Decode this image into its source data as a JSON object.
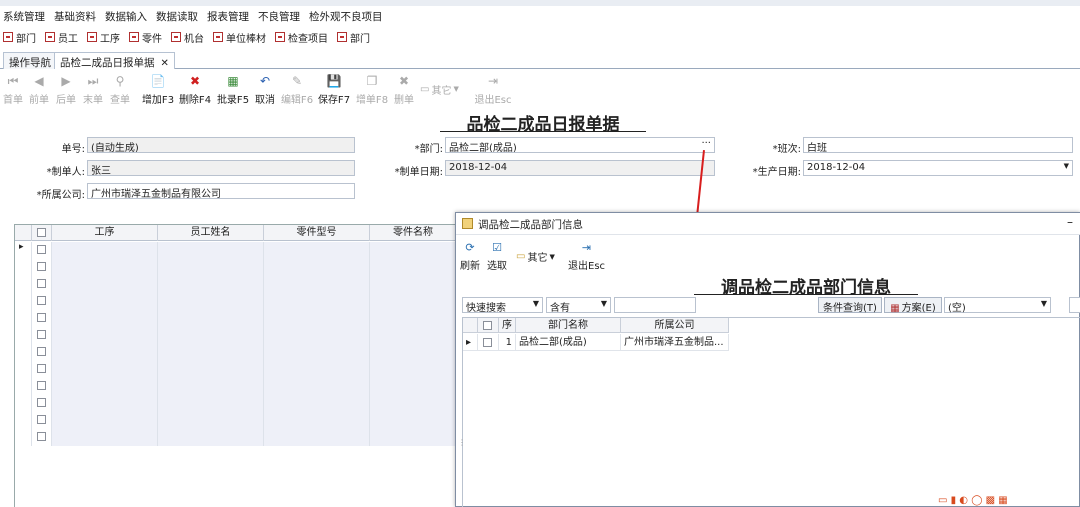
{
  "menu": [
    "系统管理",
    "基础资料",
    "数据输入",
    "数据读取",
    "报表管理",
    "不良管理",
    "检外观不良项目"
  ],
  "quick": [
    "部门",
    "员工",
    "工序",
    "零件",
    "机台",
    "单位棒材",
    "检查项目",
    "部门"
  ],
  "tabs": [
    {
      "label": "操作导航"
    },
    {
      "label": "品检二成品日报单据",
      "close": "✕"
    }
  ],
  "toolbar": {
    "first": "首单",
    "prev": "前单",
    "next": "后单",
    "last": "末单",
    "find": "查单",
    "add": "增加F3",
    "delete": "删除F4",
    "batch": "批录F5",
    "cancel": "取消",
    "edit": "编辑F6",
    "save": "保存F7",
    "copy": "增单F8",
    "remove": "删单",
    "other": "其它",
    "exit": "退出Esc"
  },
  "form": {
    "title": "品检二成品日报单据",
    "doc_no_label": "单号:",
    "doc_no": "(自动生成)",
    "dept_label": "*部门:",
    "dept": "品检二部(成品)",
    "dept_btn": "···",
    "shift_label": "*班次:",
    "shift": "白班",
    "maker_label": "*制单人:",
    "maker": "张三",
    "make_date_label": "*制单日期:",
    "make_date": "2018-12-04",
    "prod_date_label": "*生产日期:",
    "prod_date": "2018-12-04",
    "company_label": "*所属公司:",
    "company": "广州市瑞泽五金制品有限公司"
  },
  "grid": {
    "columns": [
      "工序",
      "员工姓名",
      "零件型号",
      "零件名称"
    ],
    "row_count": 12
  },
  "dialog": {
    "title": "调品检二成品部门信息",
    "minimize": "–",
    "refresh": "刷新",
    "select": "选取",
    "other": "其它",
    "exit": "退出Esc",
    "heading": "调品检二成品部门信息",
    "search_mode": "快速搜索",
    "match": "含有",
    "query_value": "",
    "cond_query": "条件查询(T)",
    "scheme": "方案(E)",
    "scheme_value": "(空)",
    "columns": [
      "序",
      "部门名称",
      "所属公司"
    ],
    "rows": [
      {
        "no": "1",
        "name": "品检二部(成品)",
        "company": "广州市瑞泽五金制品..."
      }
    ]
  }
}
